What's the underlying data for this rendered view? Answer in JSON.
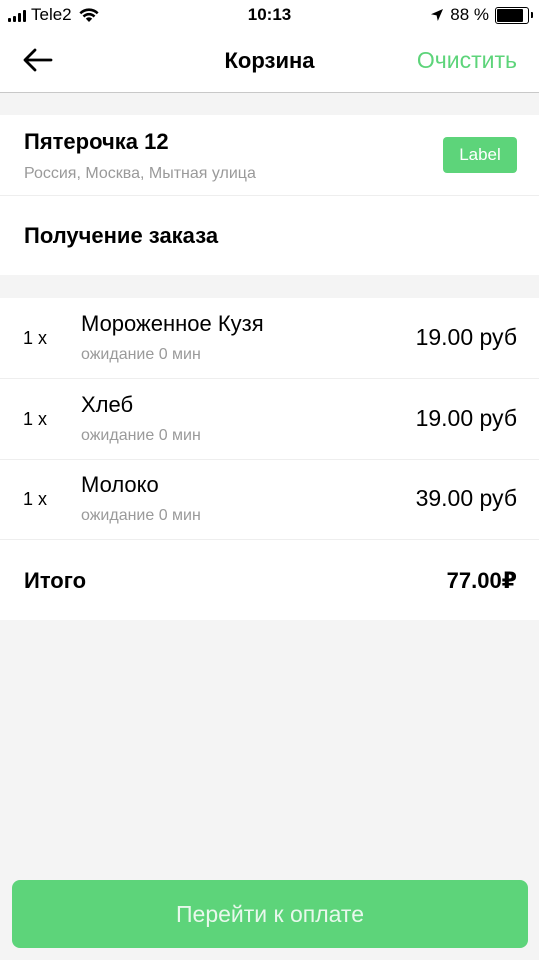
{
  "status_bar": {
    "carrier": "Tele2",
    "time": "10:13",
    "battery_percent": "88 %",
    "battery_level": 0.88,
    "icons": [
      "signal-icon",
      "wifi-icon",
      "location-arrow-icon",
      "battery-icon"
    ]
  },
  "nav": {
    "title": "Корзина",
    "clear_label": "Очистить",
    "back_icon": "back-arrow-icon"
  },
  "store": {
    "name": "Пятерочка 12",
    "address": "Россия, Москва, Мытная улица",
    "badge": "Label",
    "delivery_label": "Получение заказа"
  },
  "items": [
    {
      "qty": "1 x",
      "name": "Мороженное Кузя",
      "wait": "ожидание 0 мин",
      "price": "19.00 руб"
    },
    {
      "qty": "1 x",
      "name": "Хлеб",
      "wait": "ожидание 0 мин",
      "price": "19.00 руб"
    },
    {
      "qty": "1 x",
      "name": "Молоко",
      "wait": "ожидание 0 мин",
      "price": "39.00 руб"
    }
  ],
  "total": {
    "label": "Итого",
    "value": "77.00₽"
  },
  "pay_button_label": "Перейти к оплате",
  "colors": {
    "accent": "#5dd47a",
    "secondary_text": "#9a9a9a",
    "background": "#f4f4f4"
  }
}
